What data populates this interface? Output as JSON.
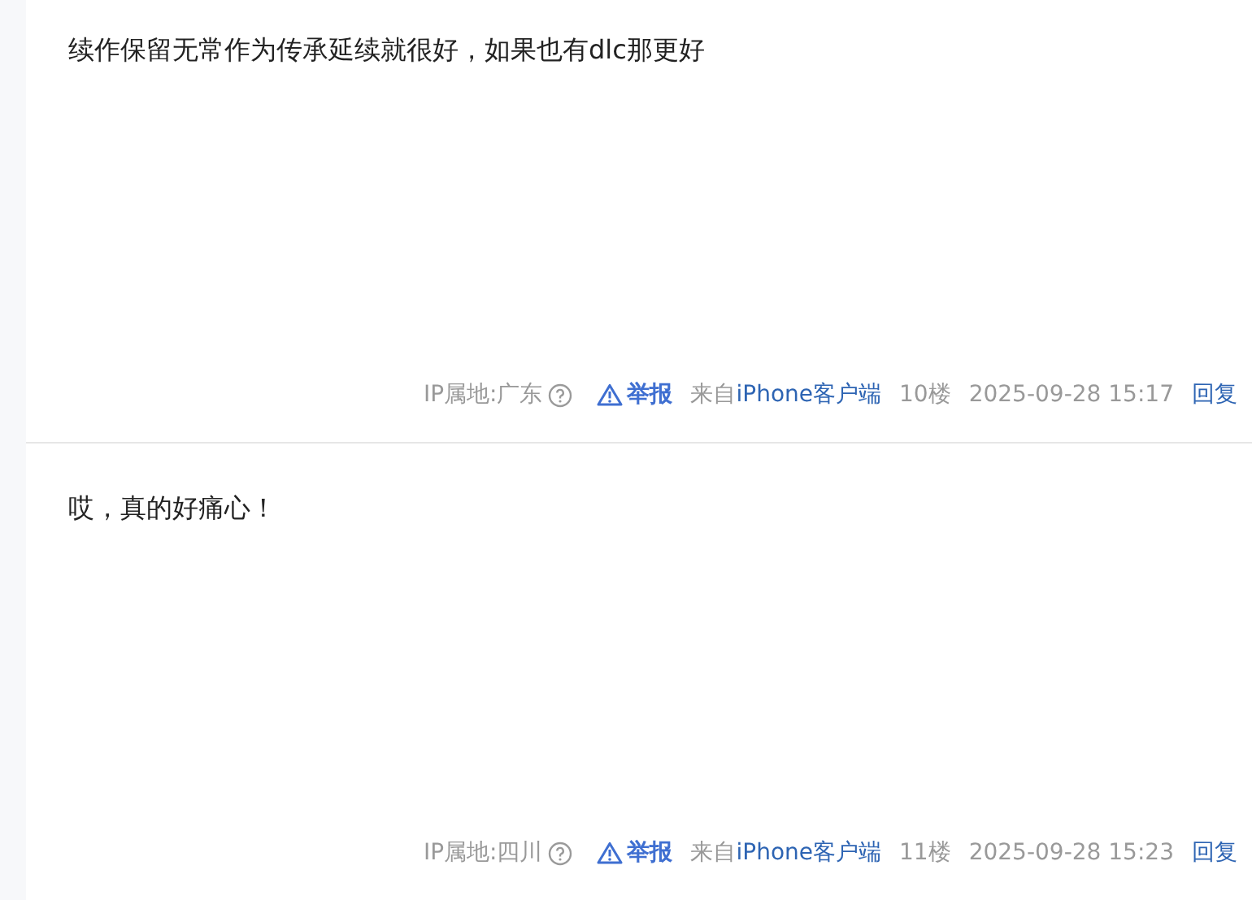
{
  "posts": [
    {
      "content": "续作保留无常作为传承延续就很好，如果也有dlc那更好",
      "ip": "IP属地:广东",
      "report": "举报",
      "from": "来自",
      "client": "iPhone客户端",
      "floor": "10楼",
      "time": "2025-09-28 15:17",
      "reply": "回复"
    },
    {
      "content": "哎，真的好痛心！",
      "ip": "IP属地:四川",
      "report": "举报",
      "from": "来自",
      "client": "iPhone客户端",
      "floor": "11楼",
      "time": "2025-09-28 15:23",
      "reply": "回复"
    }
  ]
}
